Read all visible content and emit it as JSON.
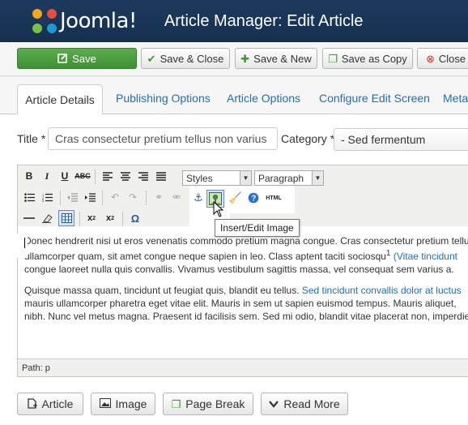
{
  "header": {
    "brand": "Joomla!",
    "title": "Article Manager: Edit Article"
  },
  "toolbar": {
    "save": "Save",
    "save_close": "Save & Close",
    "save_new": "Save & New",
    "save_copy": "Save as Copy",
    "close": "Close"
  },
  "tabs": [
    "Article Details",
    "Publishing Options",
    "Article Options",
    "Configure Edit Screen",
    "Meta"
  ],
  "form": {
    "title_label": "Title *",
    "title_value": "Cras consectetur pretium tellus non varius",
    "category_label": "Category *",
    "category_value": "- Sed fermentum"
  },
  "editor": {
    "styles_select": "Styles",
    "format_select": "Paragraph",
    "html_label": "HTML",
    "tooltip": "Insert/Edit Image",
    "paragraphs": [
      {
        "line1": "Donec hendrerit nisi ut eros venenatis commodo pretium magna congue. Cras consectetur pretium tellus",
        "line2a": "ullamcorper quam, sit amet congue neque sapien in leo. Class aptent taciti sociosqu",
        "sup": "1",
        "line2b": " (Vitae tincidunt",
        "line3": "congue laoreet nulla quis convallis. Vivamus vestibulum sagittis massa, vel consequat sem varius a."
      },
      {
        "line1a": "Quisque massa quam, tincidunt ut feugiat quis, blandit eu tellus. ",
        "line1b": "Sed tincidunt convallis dolor at luctus",
        "line2": "mauris ullamcorper pharetra eget vitae elit. Mauris in sem ut sapien euismod tempus. Mauris aliquet,",
        "line3": "nibh. Nunc vel metus magna. Praesent id facilisis sem. Sed mi odio, blandit vitae placerat non, imperdiet"
      }
    ],
    "path": "Path: p"
  },
  "bottom_buttons": {
    "article": "Article",
    "image": "Image",
    "page_break": "Page Break",
    "read_more": "Read More"
  }
}
